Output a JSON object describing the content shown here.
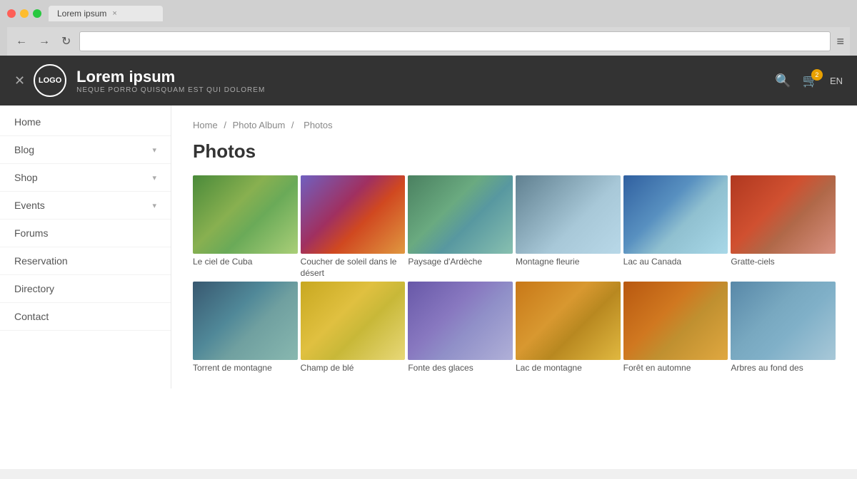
{
  "browser": {
    "tab_label": "Lorem ipsum",
    "tab_close": "×",
    "back_icon": "←",
    "forward_icon": "→",
    "refresh_icon": "↻",
    "menu_icon": "≡"
  },
  "header": {
    "close_icon": "✕",
    "logo_text": "LOGO",
    "brand_name": "Lorem ipsum",
    "brand_tagline": "NEQUE PORRO QUISQUAM EST QUI DOLOREM",
    "search_icon": "🔍",
    "cart_icon": "🛒",
    "cart_count": "2",
    "lang": "EN"
  },
  "sidebar": {
    "items": [
      {
        "label": "Home",
        "has_chevron": false
      },
      {
        "label": "Blog",
        "has_chevron": true
      },
      {
        "label": "Shop",
        "has_chevron": true
      },
      {
        "label": "Events",
        "has_chevron": true
      },
      {
        "label": "Forums",
        "has_chevron": false
      },
      {
        "label": "Reservation",
        "has_chevron": false
      },
      {
        "label": "Directory",
        "has_chevron": false
      },
      {
        "label": "Contact",
        "has_chevron": false
      }
    ]
  },
  "breadcrumb": {
    "home": "Home",
    "album": "Photo Album",
    "current": "Photos"
  },
  "page_title": "Photos",
  "photos": [
    {
      "caption": "Le ciel de Cuba",
      "color": "#6a9e5a",
      "color2": "#8ab870"
    },
    {
      "caption": "Coucher de soleil dans le désert",
      "color": "#d4622a",
      "color2": "#e8993c"
    },
    {
      "caption": "Paysage d'Ardèche",
      "color": "#5a8a6e",
      "color2": "#7ab08a"
    },
    {
      "caption": "Montagne fleurie",
      "color": "#7a9ab0",
      "color2": "#9ab8c8"
    },
    {
      "caption": "Lac au Canada",
      "color": "#5080a0",
      "color2": "#6090b8"
    },
    {
      "caption": "Gratte-ciels",
      "color": "#c05030",
      "color2": "#d06848"
    },
    {
      "caption": "Torrent de montagne",
      "color": "#608080",
      "color2": "#509090"
    },
    {
      "caption": "Champ de blé",
      "color": "#d4b840",
      "color2": "#e8cc60"
    },
    {
      "caption": "Fonte des glaces",
      "color": "#8070a8",
      "color2": "#9888b8"
    },
    {
      "caption": "Lac de montagne",
      "color": "#c09030",
      "color2": "#d8a840"
    },
    {
      "caption": "Forêt en automne",
      "color": "#c87020",
      "color2": "#e09038"
    },
    {
      "caption": "Arbres au fond des",
      "color": "#6090a0",
      "color2": "#78a8b8"
    }
  ]
}
